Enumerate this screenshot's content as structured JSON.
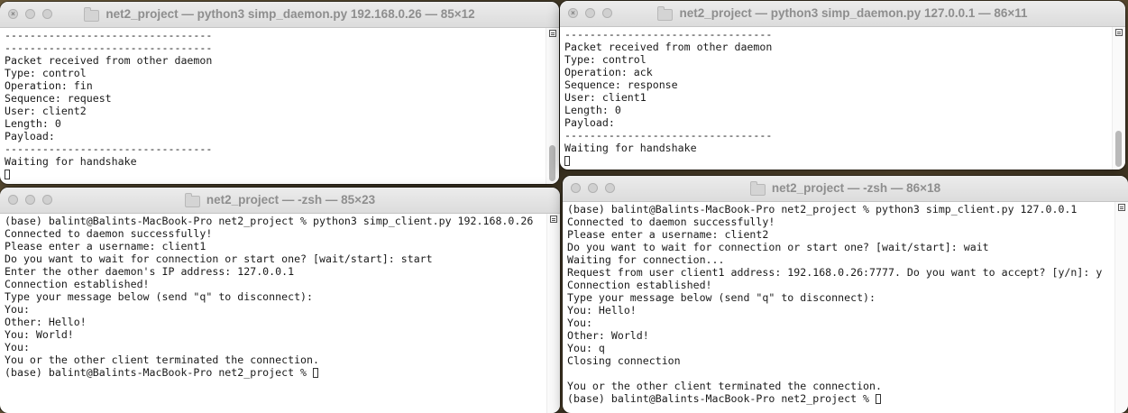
{
  "windows": [
    {
      "title": "net2_project — python3 simp_daemon.py 192.168.0.26 — 85×12",
      "lines": [
        "---------------------------------",
        "---------------------------------",
        "Packet received from other daemon",
        "Type: control",
        "Operation: fin",
        "Sequence: request",
        "User: client2",
        "Length: 0",
        "Payload:",
        "---------------------------------",
        "Waiting for handshake"
      ]
    },
    {
      "title": "net2_project — python3 simp_daemon.py 127.0.0.1 — 86×11",
      "lines": [
        "---------------------------------",
        "Packet received from other daemon",
        "Type: control",
        "Operation: ack",
        "Sequence: response",
        "User: client1",
        "Length: 0",
        "Payload:",
        "---------------------------------",
        "Waiting for handshake"
      ]
    },
    {
      "title": "net2_project — -zsh — 85×23",
      "lines": [
        "(base) balint@Balints-MacBook-Pro net2_project % python3 simp_client.py 192.168.0.26",
        "Connected to daemon successfully!",
        "Please enter a username: client1",
        "Do you want to wait for connection or start one? [wait/start]: start",
        "Enter the other daemon's IP address: 127.0.0.1",
        "Connection established!",
        "Type your message below (send \"q\" to disconnect):",
        "You:",
        "Other: Hello!",
        "You: World!",
        "You:",
        "You or the other client terminated the connection."
      ],
      "prompt": "(base) balint@Balints-MacBook-Pro net2_project % "
    },
    {
      "title": "net2_project — -zsh — 86×18",
      "lines": [
        "(base) balint@Balints-MacBook-Pro net2_project % python3 simp_client.py 127.0.0.1",
        "Connected to daemon successfully!",
        "Please enter a username: client2",
        "Do you want to wait for connection or start one? [wait/start]: wait",
        "Waiting for connection...",
        "Request from user client1 address: 192.168.0.26:7777. Do you want to accept? [y/n]: y",
        "Connection established!",
        "Type your message below (send \"q\" to disconnect):",
        "You: Hello!",
        "You:",
        "Other: World!",
        "You: q",
        "Closing connection",
        "",
        "You or the other client terminated the connection."
      ],
      "prompt": "(base) balint@Balints-MacBook-Pro net2_project % "
    }
  ]
}
